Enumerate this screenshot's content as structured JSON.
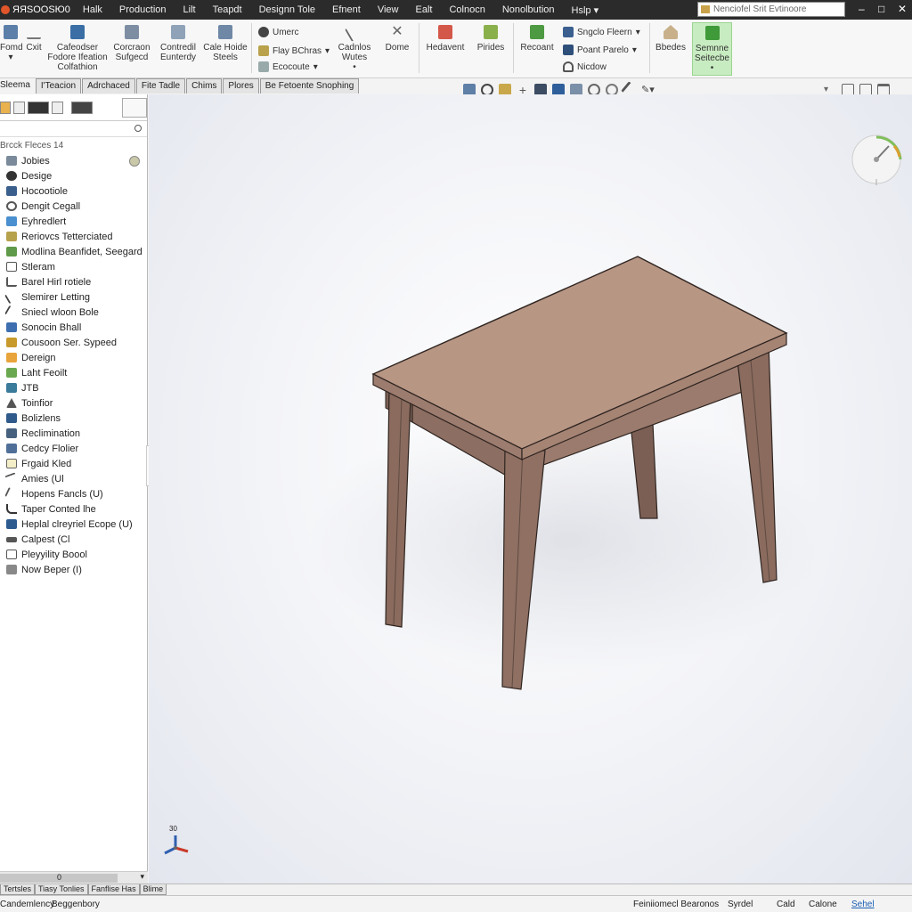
{
  "app": {
    "name": "ЯЯSOOSЮ0"
  },
  "menu": [
    "Halk",
    "Production",
    "Lilt",
    "Teapdt",
    "Designn Tole",
    "Efnent",
    "View",
    "Ealt",
    "Colnocn",
    "Nonolbution",
    "Hslp ▾"
  ],
  "search": {
    "placeholder": "Nenciofel Srit Evtinoore"
  },
  "window_controls": [
    "–",
    "□",
    "✕"
  ],
  "ribbon": {
    "left_buttons": [
      {
        "label": "Fomd",
        "sub": "▾"
      },
      {
        "label": "Cxit",
        "sub": ""
      },
      {
        "label": "Cafeodser",
        "sub": "Fodore Ifeation",
        "sub2": "Colfathion"
      },
      {
        "label": "Corcraon",
        "sub": "Sufgecd"
      },
      {
        "label": "Contredil",
        "sub": "Eunterdy"
      },
      {
        "label": "Cale Hoide",
        "sub": "Steels"
      }
    ],
    "small_group_1": [
      {
        "label": "Umerc",
        "arrow": ""
      },
      {
        "label": "Flay BChras",
        "arrow": "▾"
      },
      {
        "label": "Ecocoute",
        "arrow": "▾"
      }
    ],
    "mid_buttons": [
      {
        "label": "Cadnlos",
        "sub": "Wutes",
        "sub2": "•"
      },
      {
        "label": "Dome",
        "sub": ""
      },
      {
        "label": "Hedavent",
        "sub": ""
      },
      {
        "label": "Pirides",
        "sub": ""
      },
      {
        "label": "Recoant",
        "sub": ""
      }
    ],
    "small_group_2": [
      {
        "label": "Sngclo Fleern",
        "arrow": "▾"
      },
      {
        "label": "Poant Parelo",
        "arrow": "▾"
      },
      {
        "label": "Nicdow",
        "arrow": ""
      }
    ],
    "right_buttons": [
      {
        "label": "Bbedes",
        "sub": ""
      },
      {
        "label": "Semnne",
        "sub": "Seitecbe",
        "sub2": "•"
      }
    ]
  },
  "command_tabs": [
    "Sleema",
    "I'Teacion",
    "Adrchaced",
    "Fite Tadle",
    "Chims",
    "Plores",
    "Be Fetoente Snophing"
  ],
  "left_panel": {
    "header": "Brcck Fleces 14",
    "items": [
      "Jobies",
      "Desige",
      "Hocootiole",
      "Dengit Cegall",
      "Eyhredlert",
      "Reriovcs Tetterciated",
      "Modlina Beanfidet, Seegard",
      "Stleram",
      "Barel Hirl rotiele",
      "Slemirer Letting",
      "Sniecl wloon Bole",
      "Sonocin Bhall",
      "Cousoon Ser. Sypeed",
      "Dereign",
      "Laht Feoilt",
      "JTB",
      "Toinfior",
      "Bolizlens",
      "Reclimination",
      "Cedcy Flolier",
      "Frgaid Kled",
      "Amies (Ul",
      "Hopens Fancls (U)",
      "Taper Conted lhe",
      "Heplal clreyriel Ecope (U)",
      "Calpest (Cl",
      "Pleyyility Boool",
      "Now Beper (I)"
    ],
    "scroll_mark": "0"
  },
  "triad": {
    "label": "30"
  },
  "bottom_tabs": [
    "Tertsles",
    "Tiasy Tonlies",
    "Fanflise Has",
    "Blime"
  ],
  "status": {
    "left": "Candemlency",
    "left2": "Beggenbory",
    "r1": "Feiniiomecl Bearonos",
    "r2": "Syrdel",
    "r3": "Cald",
    "r4": "Calone",
    "r5": "Sehel"
  },
  "colors": {
    "table_top": "#b89684",
    "table_leg": "#8a6b5e",
    "accent": "#1a5fb4"
  }
}
